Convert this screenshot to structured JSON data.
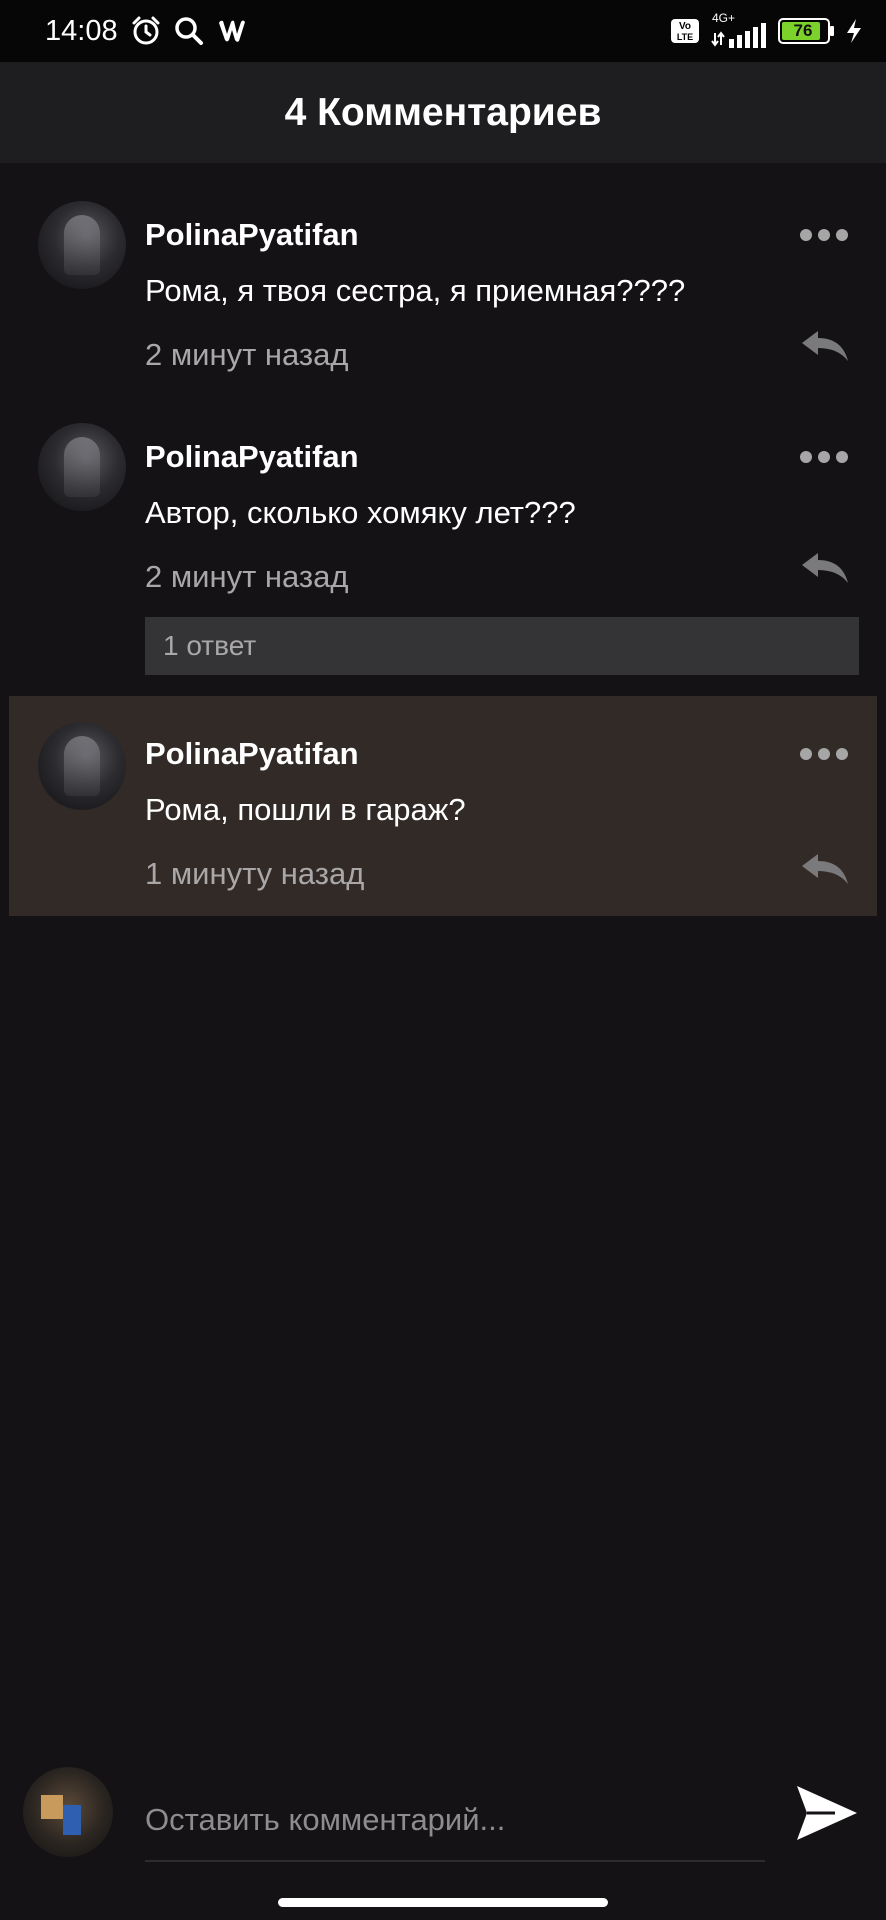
{
  "status_bar": {
    "time": "14:08",
    "network": "4G+",
    "volte": "Vo LTE",
    "battery": "76"
  },
  "header": {
    "title": "4 Комментариев"
  },
  "comments": [
    {
      "username": "PolinaPyatifan",
      "text": "Рома, я твоя сестра, я приемная????",
      "time": "2 минут назад"
    },
    {
      "username": "PolinaPyatifan",
      "text": "Автор, сколько хомяку лет???",
      "time": "2 минут назад",
      "replies_label": "1 ответ"
    },
    {
      "username": "PolinaPyatifan",
      "text": "Рома, пошли в гараж?",
      "time": "1 минуту назад",
      "highlighted": true
    }
  ],
  "composer": {
    "placeholder": "Оставить комментарий..."
  },
  "icons": {
    "status": [
      "alarm-icon",
      "search-icon",
      "wattpad-icon",
      "volte-icon",
      "signal-icon",
      "battery-icon",
      "charging-icon"
    ],
    "comment": [
      "more-icon",
      "reply-icon"
    ],
    "composer": [
      "send-icon"
    ]
  },
  "colors": {
    "background": "#141215",
    "header": "#1e1d1f",
    "highlight": "#322a27",
    "muted_text": "#a9a7a8",
    "battery": "#7cd12a"
  }
}
